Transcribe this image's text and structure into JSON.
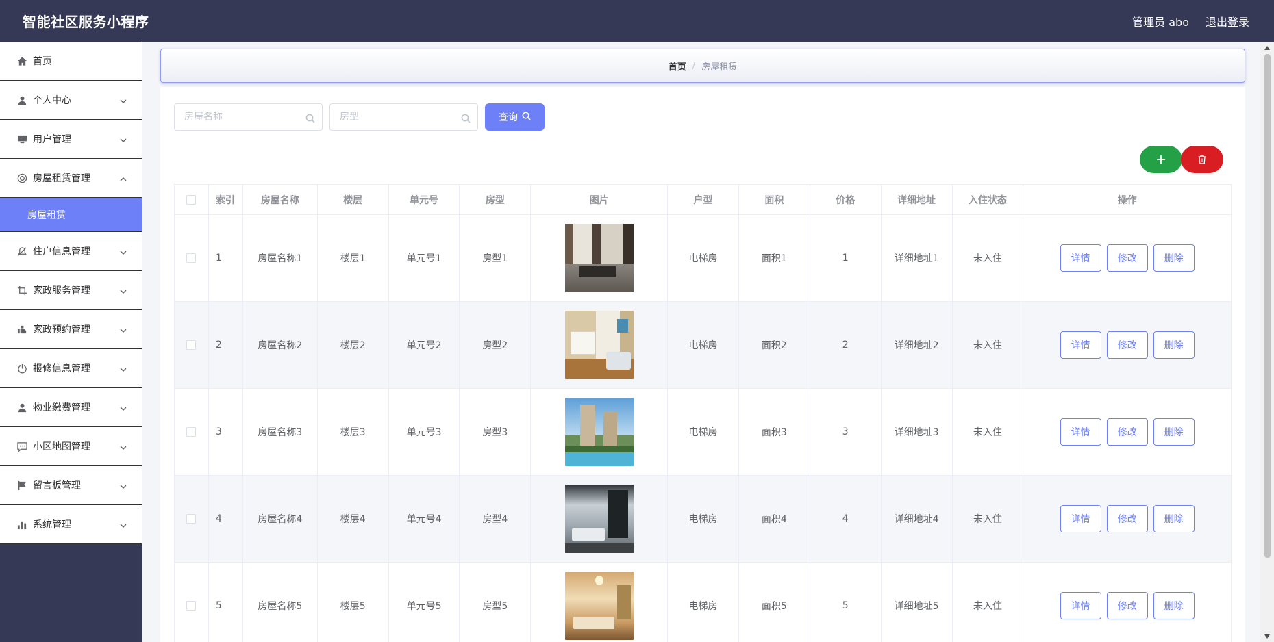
{
  "header": {
    "app_title": "智能社区服务小程序",
    "user_label": "管理员 abo",
    "logout_label": "退出登录"
  },
  "sidebar": {
    "items": [
      {
        "label": "首页",
        "icon": "home-icon"
      },
      {
        "label": "个人中心",
        "icon": "user-icon"
      },
      {
        "label": "用户管理",
        "icon": "monitor-icon"
      },
      {
        "label": "房屋租赁管理",
        "icon": "lifebuoy-icon",
        "expanded": true
      },
      {
        "label": "住户信息管理",
        "icon": "mute-bell-icon"
      },
      {
        "label": "家政服务管理",
        "icon": "crop-icon"
      },
      {
        "label": "家政预约管理",
        "icon": "hand-icon"
      },
      {
        "label": "报修信息管理",
        "icon": "power-icon"
      },
      {
        "label": "物业缴费管理",
        "icon": "user-icon"
      },
      {
        "label": "小区地图管理",
        "icon": "chat-icon"
      },
      {
        "label": "留言板管理",
        "icon": "flag-icon"
      },
      {
        "label": "系统管理",
        "icon": "bar-chart-icon"
      }
    ],
    "active_submenu": "房屋租赁"
  },
  "breadcrumb": {
    "home": "首页",
    "separator": "/",
    "current": "房屋租赁"
  },
  "search": {
    "name_placeholder": "房屋名称",
    "type_placeholder": "房型",
    "query_label": "查询"
  },
  "colors": {
    "primary": "#6d80f7",
    "add": "#24a046",
    "delete": "#d81e22",
    "nav_bg": "#353956"
  },
  "table": {
    "headers": {
      "index": "索引",
      "name": "房屋名称",
      "floor": "楼层",
      "unit": "单元号",
      "type": "房型",
      "image": "图片",
      "layout": "户型",
      "area": "面积",
      "price": "价格",
      "address": "详细地址",
      "status": "入住状态",
      "ops": "操作"
    },
    "rows": [
      {
        "index": "1",
        "name": "房屋名称1",
        "floor": "楼层1",
        "unit": "单元号1",
        "type": "房型1",
        "layout": "电梯房",
        "area": "面积1",
        "price": "1",
        "address": "详细地址1",
        "status": "未入住"
      },
      {
        "index": "2",
        "name": "房屋名称2",
        "floor": "楼层2",
        "unit": "单元号2",
        "type": "房型2",
        "layout": "电梯房",
        "area": "面积2",
        "price": "2",
        "address": "详细地址2",
        "status": "未入住"
      },
      {
        "index": "3",
        "name": "房屋名称3",
        "floor": "楼层3",
        "unit": "单元号3",
        "type": "房型3",
        "layout": "电梯房",
        "area": "面积3",
        "price": "3",
        "address": "详细地址3",
        "status": "未入住"
      },
      {
        "index": "4",
        "name": "房屋名称4",
        "floor": "楼层4",
        "unit": "单元号4",
        "type": "房型4",
        "layout": "电梯房",
        "area": "面积4",
        "price": "4",
        "address": "详细地址4",
        "status": "未入住"
      },
      {
        "index": "5",
        "name": "房屋名称5",
        "floor": "楼层5",
        "unit": "单元号5",
        "type": "房型5",
        "layout": "电梯房",
        "area": "面积5",
        "price": "5",
        "address": "详细地址5",
        "status": "未入住"
      }
    ],
    "ops": {
      "detail": "详情",
      "edit": "修改",
      "delete": "删除"
    }
  }
}
